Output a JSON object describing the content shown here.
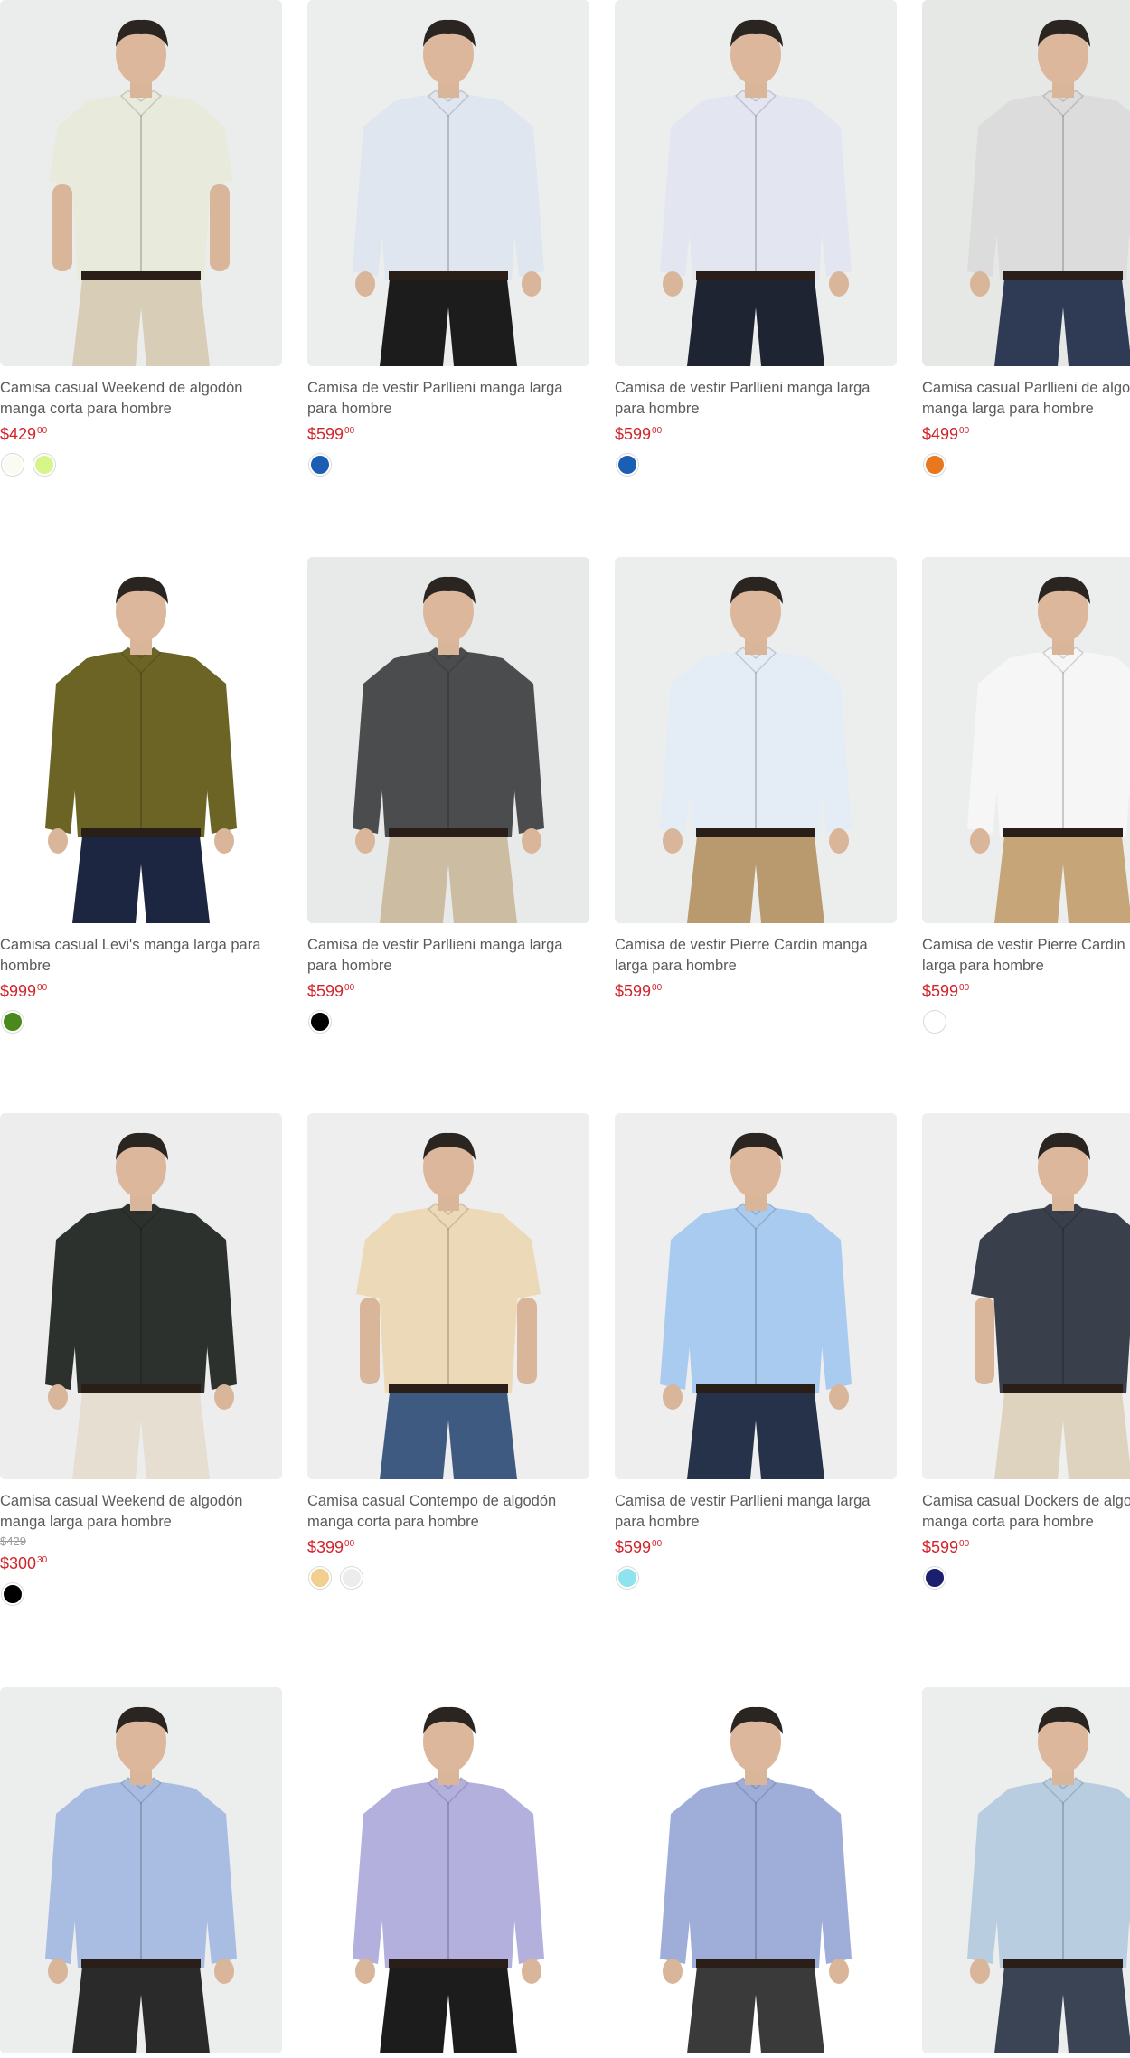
{
  "products": [
    {
      "title1": "Camisa casual Weekend de algodón",
      "title2": "manga corta para hombre",
      "old_price": "",
      "price_main": "$429",
      "price_cents": "00",
      "swatches": [
        "#fbfbf3",
        "#d8f58a"
      ],
      "image": "man-striped-short-sleeve-shirt",
      "colors": {
        "shirt": "#e8eadc",
        "pants": "#d8cdb6",
        "bg": "#ebedec"
      }
    },
    {
      "title1": "Camisa de vestir Parllieni manga larga",
      "title2": "para hombre",
      "old_price": "",
      "price_main": "$599",
      "price_cents": "00",
      "swatches": [
        "#1a5fb4"
      ],
      "image": "man-light-blue-dress-shirt",
      "colors": {
        "shirt": "#dfe6f0",
        "pants": "#1c1c1c",
        "bg": "#eceeee"
      }
    },
    {
      "title1": "Camisa de vestir Parllieni manga larga",
      "title2": "para hombre",
      "old_price": "",
      "price_main": "$599",
      "price_cents": "00",
      "swatches": [
        "#1a5fb4"
      ],
      "image": "man-white-dress-shirt",
      "colors": {
        "shirt": "#e3e6f1",
        "pants": "#1f2433",
        "bg": "#eceeee"
      }
    },
    {
      "title1": "Camisa casual Parllieni de algo",
      "title2": "manga larga para hombre",
      "old_price": "",
      "price_main": "$499",
      "price_cents": "00",
      "swatches": [
        "#e8771e"
      ],
      "image": "man-grey-casual-shirt",
      "colors": {
        "shirt": "#dcdcdc",
        "pants": "#2f3a55",
        "bg": "#e6e8e6"
      }
    },
    {
      "title1": "Camisa casual Levi's manga larga para",
      "title2": "hombre",
      "old_price": "",
      "price_main": "$999",
      "price_cents": "00",
      "swatches": [
        "#4a8a1c"
      ],
      "image": "man-olive-levis-shirt",
      "colors": {
        "shirt": "#6b6425",
        "pants": "#1d2640",
        "bg": "#ffffff"
      }
    },
    {
      "title1": "Camisa de vestir Parllieni manga larga",
      "title2": "para hombre",
      "old_price": "",
      "price_main": "$599",
      "price_cents": "00",
      "swatches": [
        "#000000"
      ],
      "image": "man-charcoal-dress-shirt",
      "colors": {
        "shirt": "#4a4c4d",
        "pants": "#cbbca2",
        "bg": "#e8eae9"
      }
    },
    {
      "title1": "Camisa de vestir Pierre Cardin manga",
      "title2": "larga para hombre",
      "old_price": "",
      "price_main": "$599",
      "price_cents": "00",
      "swatches": [],
      "image": "man-light-blue-pierre-cardin-shirt",
      "colors": {
        "shirt": "#e4ecf6",
        "pants": "#b99a6e",
        "bg": "#eceeee"
      }
    },
    {
      "title1": "Camisa de vestir Pierre Cardin",
      "title2": "larga para hombre",
      "old_price": "",
      "price_main": "$599",
      "price_cents": "00",
      "swatches": [
        "#ffffff"
      ],
      "image": "man-white-pierre-cardin-shirt",
      "colors": {
        "shirt": "#f6f6f6",
        "pants": "#c6a678",
        "bg": "#eceeee"
      }
    },
    {
      "title1": "Camisa casual Weekend de algodón",
      "title2": "manga larga para hombre",
      "old_price": "$429",
      "price_main": "$300",
      "price_cents": "30",
      "swatches": [
        "#000000"
      ],
      "image": "man-black-plaid-overshirt",
      "colors": {
        "shirt": "#2c312d",
        "pants": "#e6ded0",
        "bg": "#ededed"
      }
    },
    {
      "title1": "Camisa casual Contempo de algodón",
      "title2": "manga corta para hombre",
      "old_price": "",
      "price_main": "$399",
      "price_cents": "00",
      "swatches": [
        "#f3cf8f",
        "#ececec"
      ],
      "image": "man-beige-paisley-short-sleeve-shirt",
      "colors": {
        "shirt": "#ecd9b8",
        "pants": "#3e5a80",
        "bg": "#eeeeee"
      }
    },
    {
      "title1": "Camisa de vestir Parllieni manga larga",
      "title2": "para hombre",
      "old_price": "",
      "price_main": "$599",
      "price_cents": "00",
      "swatches": [
        "#8ee3ee"
      ],
      "image": "man-sky-blue-dress-shirt",
      "colors": {
        "shirt": "#a9cbef",
        "pants": "#26324a",
        "bg": "#eeeeee"
      }
    },
    {
      "title1": "Camisa casual Dockers de algo",
      "title2": "manga corta para hombre",
      "old_price": "",
      "price_main": "$599",
      "price_cents": "00",
      "swatches": [
        "#1a1f6e"
      ],
      "image": "man-navy-check-short-sleeve-shirt",
      "colors": {
        "shirt": "#3a3f4c",
        "pants": "#ddd3bf",
        "bg": "#efefef"
      }
    },
    {
      "title1": "",
      "title2": "",
      "old_price": "",
      "price_main": "",
      "price_cents": "",
      "swatches": [],
      "image": "man-blue-oxford-shirt",
      "colors": {
        "shirt": "#a9bde2",
        "pants": "#2a2a2a",
        "bg": "#eceeee"
      }
    },
    {
      "title1": "",
      "title2": "",
      "old_price": "",
      "price_main": "",
      "price_cents": "",
      "swatches": [],
      "image": "man-lavender-dress-shirt",
      "colors": {
        "shirt": "#b3b0de",
        "pants": "#1c1c1c",
        "bg": "#ffffff"
      }
    },
    {
      "title1": "",
      "title2": "",
      "old_price": "",
      "price_main": "",
      "price_cents": "",
      "swatches": [],
      "image": "man-blue-check-dress-shirt",
      "colors": {
        "shirt": "#9fadd9",
        "pants": "#3a3a3a",
        "bg": "#ffffff"
      }
    },
    {
      "title1": "",
      "title2": "",
      "old_price": "",
      "price_main": "",
      "price_cents": "",
      "swatches": [],
      "image": "man-light-blue-plus-size-shirt",
      "colors": {
        "shirt": "#b9cde0",
        "pants": "#3a4455",
        "bg": "#eceeee"
      }
    }
  ]
}
